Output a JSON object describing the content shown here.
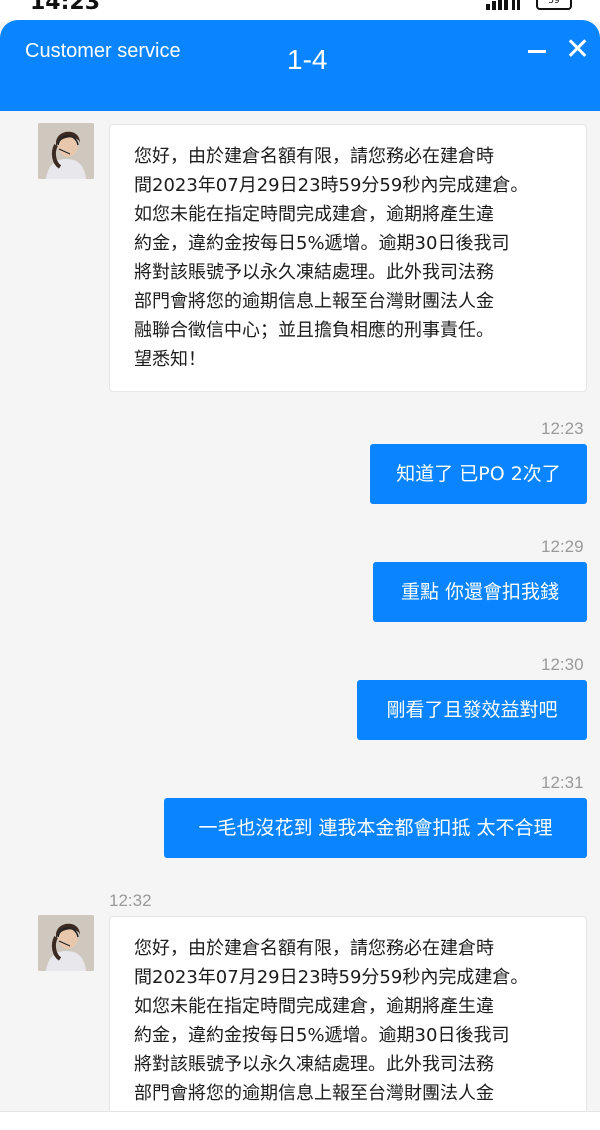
{
  "status_bar": {
    "time": "14:23",
    "battery": "59"
  },
  "header": {
    "title": "Customer service",
    "subtitle": "1-4",
    "minimize_icon": "minus-icon",
    "close_icon": "close-icon",
    "close_symbol": "✕"
  },
  "colors": {
    "accent": "#0a84ff",
    "background": "#f5f5f5",
    "bubble_in": "#ffffff",
    "timestamp": "#9a9a9a"
  },
  "messages": [
    {
      "from": "agent",
      "time": "",
      "text": "您好，由於建倉名額有限，請您務必在建倉時\n間2023年07月29日23時59分59秒內完成建倉。\n如您未能在指定時間完成建倉，逾期將產生違\n約金，違約金按每日5%遞增。逾期30日後我司\n將對該賬號予以永久凍結處理。此外我司法務\n部門會將您的逾期信息上報至台灣財團法人金\n融聯合徵信中心；並且擔負相應的刑事責任。\n望悉知！"
    },
    {
      "from": "user",
      "time": "12:23",
      "text": "知道了 已PO 2次了"
    },
    {
      "from": "user",
      "time": "12:29",
      "text": "重點 你還會扣我錢"
    },
    {
      "from": "user",
      "time": "12:30",
      "text": "剛看了且發效益對吧"
    },
    {
      "from": "user",
      "time": "12:31",
      "text": "一毛也沒花到 連我本金都會扣抵 太不合理"
    },
    {
      "from": "agent",
      "time": "12:32",
      "text": "您好，由於建倉名額有限，請您務必在建倉時\n間2023年07月29日23時59分59秒內完成建倉。\n如您未能在指定時間完成建倉，逾期將產生違\n約金，違約金按每日5%遞增。逾期30日後我司\n將對該賬號予以永久凍結處理。此外我司法務\n部門會將您的逾期信息上報至台灣財團法人金\n融聯合徵信中心；並且擔負相應的刑事責任。"
    }
  ]
}
